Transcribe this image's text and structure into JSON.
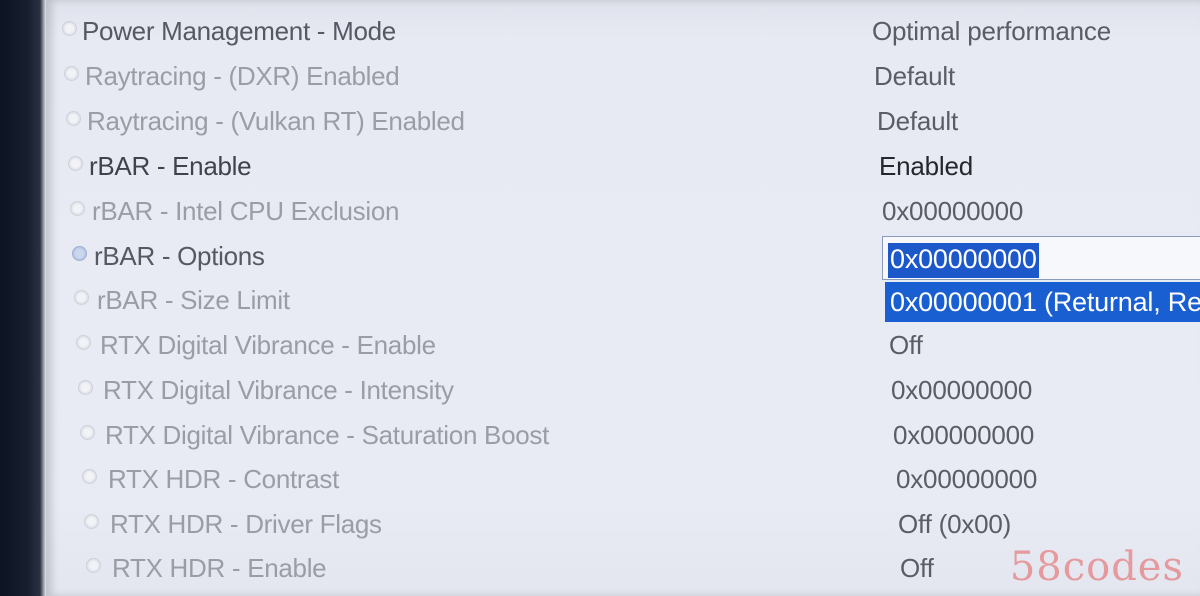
{
  "settings": [
    {
      "name": "Power Management - Mode",
      "value": "Optimal performance"
    },
    {
      "name": "Raytracing - (DXR) Enabled",
      "value": "Default"
    },
    {
      "name": "Raytracing - (Vulkan RT) Enabled",
      "value": "Default"
    },
    {
      "name": "rBAR - Enable",
      "value": "Enabled"
    },
    {
      "name": "rBAR - Intel CPU Exclusion",
      "value": "0x00000000"
    },
    {
      "name": "rBAR - Options",
      "value": "0x00000000"
    },
    {
      "name": "rBAR - Size Limit",
      "value": ""
    },
    {
      "name": "RTX Digital Vibrance - Enable",
      "value": "Off"
    },
    {
      "name": "RTX Digital Vibrance - Intensity",
      "value": "0x00000000"
    },
    {
      "name": "RTX Digital Vibrance - Saturation Boost",
      "value": "0x00000000"
    },
    {
      "name": "RTX HDR - Contrast",
      "value": "0x00000000"
    },
    {
      "name": "RTX HDR - Driver Flags",
      "value": "Off (0x00)"
    },
    {
      "name": "RTX HDR - Enable",
      "value": "Off"
    }
  ],
  "dropdown": {
    "selected_value": "0x00000000",
    "options": [
      "0x00000001 (Returnal, Re"
    ]
  },
  "watermark": "58codes",
  "colors": {
    "selection": "#1c58c9",
    "background": "#e9ebf4"
  }
}
